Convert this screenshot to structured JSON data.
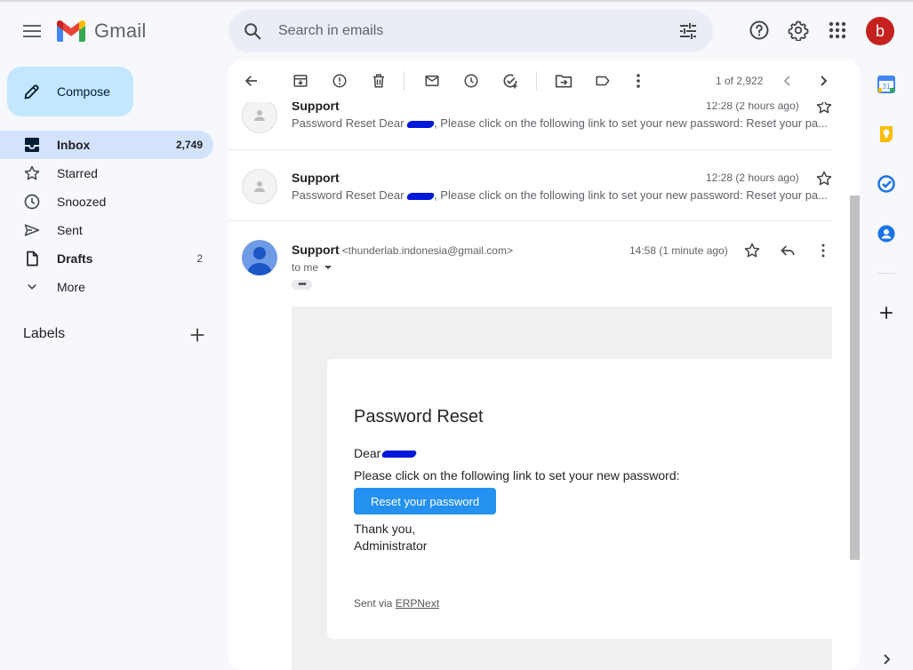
{
  "app": {
    "name": "Gmail"
  },
  "colors": {
    "accent": "#0b57d0",
    "compose_bg": "#c2e7ff",
    "active_nav": "#d3e3fd",
    "button_blue": "#2490ef",
    "avatar_red": "#c5221f"
  },
  "header": {
    "search_placeholder": "Search in emails",
    "avatar_letter": "b",
    "icons": [
      "menu-icon",
      "search-icon",
      "tune-icon",
      "help-icon",
      "settings-icon",
      "apps-icon"
    ]
  },
  "sidebar": {
    "compose_label": "Compose",
    "items": [
      {
        "label": "Inbox",
        "count": "2,749",
        "icon": "inbox-icon",
        "active": true
      },
      {
        "label": "Starred",
        "count": "",
        "icon": "star-icon"
      },
      {
        "label": "Snoozed",
        "count": "",
        "icon": "clock-icon"
      },
      {
        "label": "Sent",
        "count": "",
        "icon": "send-icon"
      },
      {
        "label": "Drafts",
        "count": "2",
        "icon": "draft-icon"
      },
      {
        "label": "More",
        "count": "",
        "icon": "chevron-down-icon"
      }
    ],
    "labels_header": "Labels"
  },
  "toolbar": {
    "pager": "1 of 2,922",
    "icons": [
      "back-icon",
      "archive-icon",
      "report-spam-icon",
      "delete-icon",
      "mark-unread-icon",
      "snooze-icon",
      "add-task-icon",
      "move-to-icon",
      "label-icon",
      "more-vert-icon",
      "chevron-left-icon",
      "chevron-right-icon"
    ]
  },
  "thread": {
    "collapsed": [
      {
        "sender": "Support",
        "time": "12:28 (2 hours ago)",
        "snippet_before": "Password Reset Dear ",
        "snippet_after": ", Please click on the following link to set your new password: Reset your pa..."
      },
      {
        "sender": "Support",
        "time": "12:28 (2 hours ago)",
        "snippet_before": "Password Reset Dear ",
        "snippet_after": ", Please click on the following link to set your new password: Reset your pa..."
      }
    ],
    "open": {
      "sender": "Support",
      "email": "<thunderlab.indonesia@gmail.com>",
      "time": "14:58 (1 minute ago)",
      "to": "to me",
      "dots": "•••",
      "body": {
        "title": "Password Reset",
        "greeting": "Dear",
        "line": "Please click on the following link to set your new password:",
        "button": "Reset your password",
        "thanks": "Thank you,",
        "signoff": "Administrator",
        "sent_via_prefix": "Sent via ",
        "sent_via_link": "ERPNext"
      }
    }
  },
  "right_rail": {
    "icons": [
      "calendar-icon",
      "keep-icon",
      "tasks-icon",
      "contacts-icon",
      "add-icon",
      "chevron-right-icon"
    ],
    "calendar_day": "31"
  }
}
